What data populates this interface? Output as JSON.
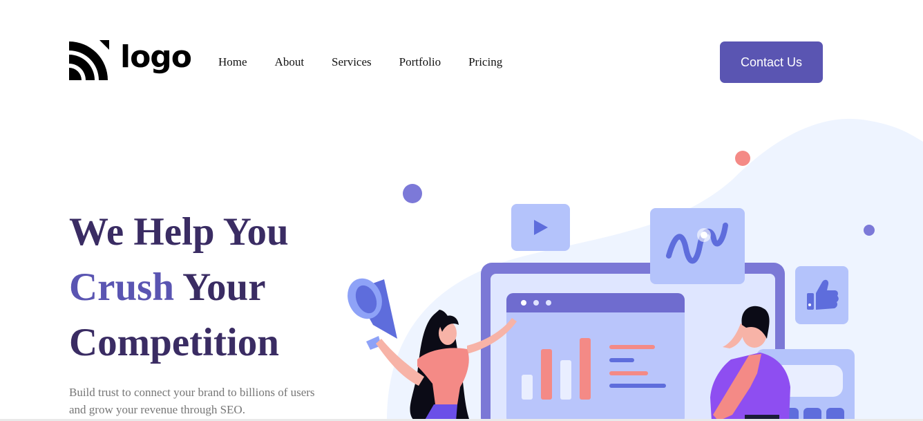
{
  "header": {
    "logo_text": "logo",
    "nav": [
      "Home",
      "About",
      "Services",
      "Portfolio",
      "Pricing"
    ],
    "cta_label": "Contact Us"
  },
  "hero": {
    "title_line1": "We Help You",
    "title_accent": "Crush",
    "title_line2_rest": " Your",
    "title_line3": "Competition",
    "description": "Build trust to connect your brand to billions of users and grow your revenue through SEO."
  },
  "colors": {
    "brand": "#5a55b2",
    "heading": "#3a2c63",
    "coral": "#f48a86",
    "periwinkle": "#b4c3fb",
    "blob": "#eef4ff"
  },
  "icons": [
    "logo-mark-icon",
    "play-icon",
    "wave-chart-icon",
    "thumbs-up-icon",
    "megaphone-icon"
  ]
}
